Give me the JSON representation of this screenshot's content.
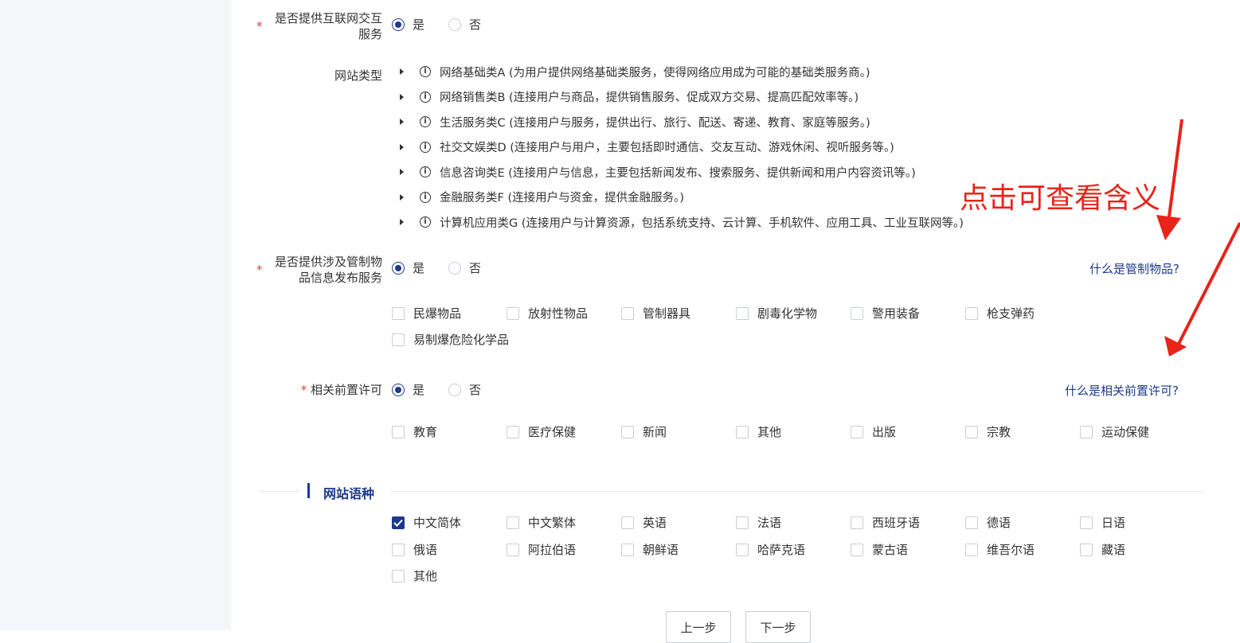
{
  "q_interactive": {
    "label_line1": "是否提供互联网交互",
    "label_line2": "服务",
    "required_mark": "*",
    "options": [
      "是",
      "否"
    ]
  },
  "site_type": {
    "label": "网站类型",
    "info_glyph": "i",
    "items": [
      "网络基础类A (为用户提供网络基础类服务，使得网络应用成为可能的基础类服务商。)",
      "网络销售类B (连接用户与商品，提供销售服务、促成双方交易、提高匹配效率等。)",
      "生活服务类C (连接用户与服务，提供出行、旅行、配送、寄递、教育、家庭等服务。)",
      "社交文娱类D (连接用户与用户，主要包括即时通信、交友互动、游戏休闲、视听服务等。)",
      "信息咨询类E (连接用户与信息，主要包括新闻发布、搜索服务、提供新闻和用户内容资讯等。)",
      "金融服务类F (连接用户与资金，提供金融服务。)",
      "计算机应用类G (连接用户与计算资源，包括系统支持、云计算、手机软件、应用工具、工业互联网等。)"
    ]
  },
  "annotation": {
    "text": "点击可查看含义",
    "color": "#e8231a"
  },
  "q_controlled": {
    "label_line1": "是否提供涉及管制物",
    "label_line2": "品信息发布服务",
    "required_mark": "*",
    "options": [
      "是",
      "否"
    ],
    "help_link": "什么是管制物品?",
    "items": [
      "民爆物品",
      "放射性物品",
      "管制器具",
      "剧毒化学物",
      "警用装备",
      "枪支弹药",
      "易制爆危险化学品"
    ]
  },
  "q_permit": {
    "label": "相关前置许可",
    "required_mark": "*",
    "options": [
      "是",
      "否"
    ],
    "help_link": "什么是相关前置许可?",
    "items": [
      "教育",
      "医疗保健",
      "新闻",
      "其他",
      "出版",
      "宗教",
      "运动保健"
    ]
  },
  "language": {
    "title": "网站语种",
    "items": [
      "中文简体",
      "中文繁体",
      "英语",
      "法语",
      "西班牙语",
      "德语",
      "日语",
      "俄语",
      "阿拉伯语",
      "朝鲜语",
      "哈萨克语",
      "蒙古语",
      "维吾尔语",
      "藏语",
      "其他"
    ],
    "checked": [
      "中文简体"
    ]
  },
  "nav": {
    "prev": "上一步",
    "next": "下一步"
  },
  "colors": {
    "accent": "#1d3a8a",
    "required": "#e23c3c",
    "sidebar_bg": "#f5f6f9"
  }
}
